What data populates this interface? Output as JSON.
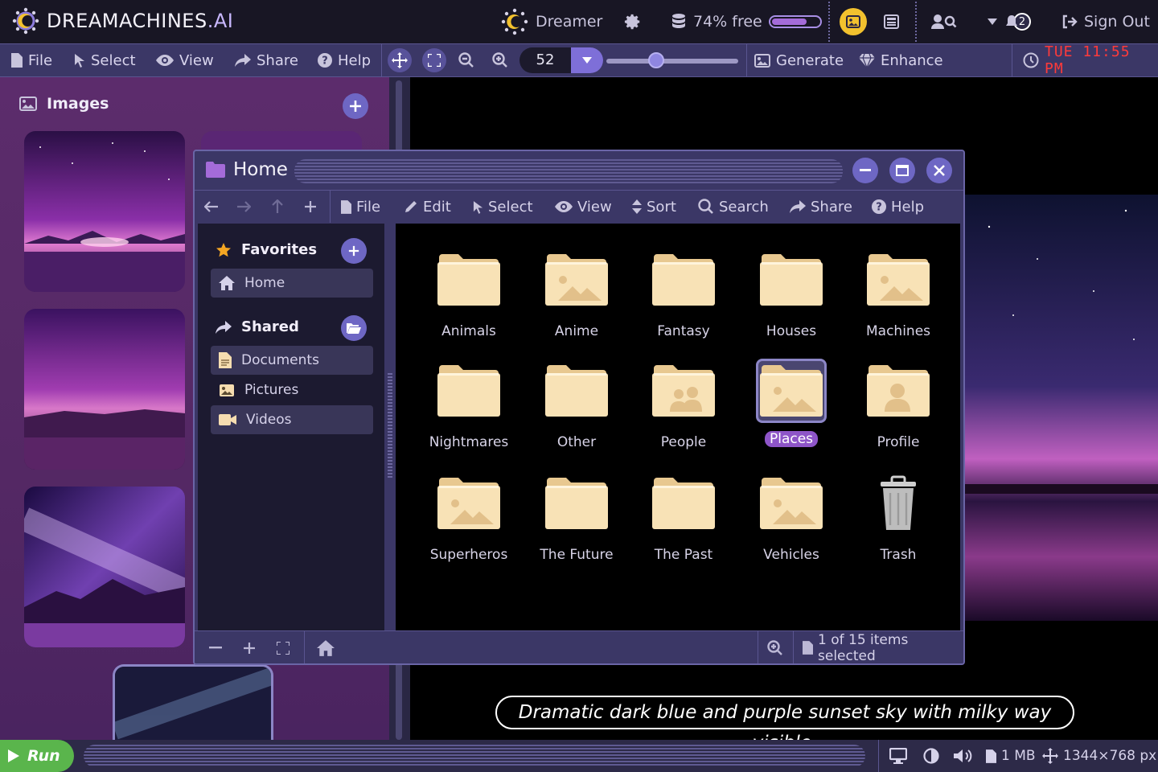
{
  "brand": {
    "name_main": "DREAMACHINES",
    "name_suffix": ".AI"
  },
  "topbar": {
    "user": "Dreamer",
    "storage": "74% free",
    "storage_fraction": 0.74,
    "notifications": "2",
    "signout": "Sign Out"
  },
  "menubar": {
    "file": "File",
    "select": "Select",
    "view": "View",
    "share": "Share",
    "help": "Help",
    "zoom_value": "52",
    "zoom_slider_fraction": 0.38,
    "generate": "Generate",
    "enhance": "Enhance",
    "clock": "TUE 11:55 PM"
  },
  "left_panel": {
    "title": "Images"
  },
  "caption": "Dramatic dark blue and purple sunset sky with milky way visible.",
  "bottombar": {
    "run": "Run",
    "file_size": "1 MB",
    "dimensions": "1344×768 px"
  },
  "file_window": {
    "title": "Home",
    "toolbar": {
      "file": "File",
      "edit": "Edit",
      "select": "Select",
      "view": "View",
      "sort": "Sort",
      "search": "Search",
      "share": "Share",
      "help": "Help"
    },
    "sidebar": {
      "favorites": "Favorites",
      "home": "Home",
      "shared": "Shared",
      "documents": "Documents",
      "pictures": "Pictures",
      "videos": "Videos"
    },
    "folders": [
      {
        "label": "Animals"
      },
      {
        "label": "Anime"
      },
      {
        "label": "Fantasy"
      },
      {
        "label": "Houses"
      },
      {
        "label": "Machines"
      },
      {
        "label": "Nightmares"
      },
      {
        "label": "Other"
      },
      {
        "label": "People"
      },
      {
        "label": "Places"
      },
      {
        "label": "Profile"
      },
      {
        "label": "Superheros"
      },
      {
        "label": "The Future"
      },
      {
        "label": "The Past"
      },
      {
        "label": "Vehicles"
      },
      {
        "label": "Trash"
      }
    ],
    "status": "1 of 15 items selected"
  },
  "colors": {
    "accent": "#6e67c4",
    "selection": "#8e55c8",
    "run_green": "#5ab54c",
    "clock_red": "#ff3a3a",
    "folder": "#f6ddb0"
  }
}
